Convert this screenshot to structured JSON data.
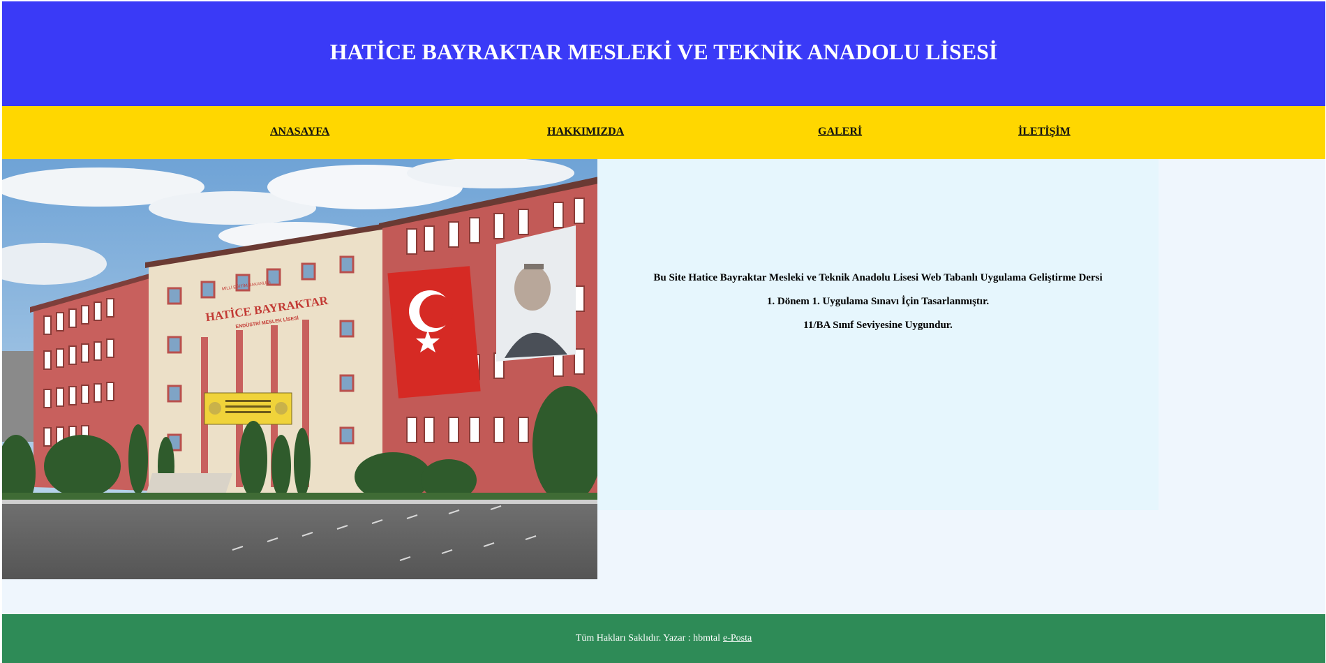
{
  "header": {
    "title": "HATİCE BAYRAKTAR MESLEKİ VE TEKNİK ANADOLU LİSESİ"
  },
  "nav": {
    "items": [
      {
        "label": "ANASAYFA"
      },
      {
        "label": "HAKKIMIZDA"
      },
      {
        "label": "GALERİ"
      },
      {
        "label": "İLETİŞİM"
      }
    ]
  },
  "photo": {
    "building_sign": "HATİCE BAYRAKTAR",
    "building_subsign": "ENDÜSTRİ MESLEK LİSESİ",
    "ministry_sign": "MİLLİ EĞİTİM BAKANLIĞI"
  },
  "info": {
    "lines": [
      "Bu Site Hatice Bayraktar Mesleki ve Teknik Anadolu Lisesi Web Tabanlı Uygulama Geliştirme Dersi",
      "1. Dönem 1. Uygulama Sınavı İçin Tasarlanmıştır.",
      "11/BA Sınıf Seviyesine Uygundur."
    ]
  },
  "footer": {
    "text": "Tüm Hakları Saklıdır. Yazar : hbmtal",
    "email_link": "e-Posta"
  },
  "colors": {
    "header_bg": "#3a3af7",
    "nav_bg": "#ffd700",
    "main_bg": "#eff6fd",
    "info_bg": "#e6f6fd",
    "footer_bg": "#2e8b57"
  }
}
